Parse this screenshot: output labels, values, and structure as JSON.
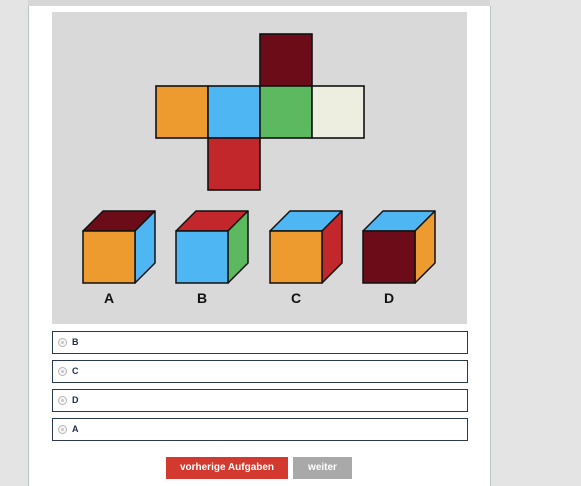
{
  "figure": {
    "colors": {
      "orange": "#ed9a2f",
      "blue": "#4fb6f4",
      "green": "#5db95f",
      "cream": "#eeeee0",
      "red": "#c1272b",
      "maroon": "#6b0c18"
    },
    "net": {
      "top": "maroon",
      "left": "orange",
      "center": "blue",
      "right": "green",
      "far_right": "cream",
      "bottom": "red"
    },
    "cubes": [
      {
        "label": "A",
        "front": "orange",
        "top": "maroon",
        "side": "blue"
      },
      {
        "label": "B",
        "front": "blue",
        "top": "red",
        "side": "green"
      },
      {
        "label": "C",
        "front": "orange",
        "top": "blue",
        "side": "red"
      },
      {
        "label": "D",
        "front": "maroon",
        "top": "blue",
        "side": "orange"
      }
    ]
  },
  "options": [
    "B",
    "C",
    "D",
    "A"
  ],
  "buttons": {
    "previous": "vorherige Aufgaben",
    "next": "weiter"
  }
}
